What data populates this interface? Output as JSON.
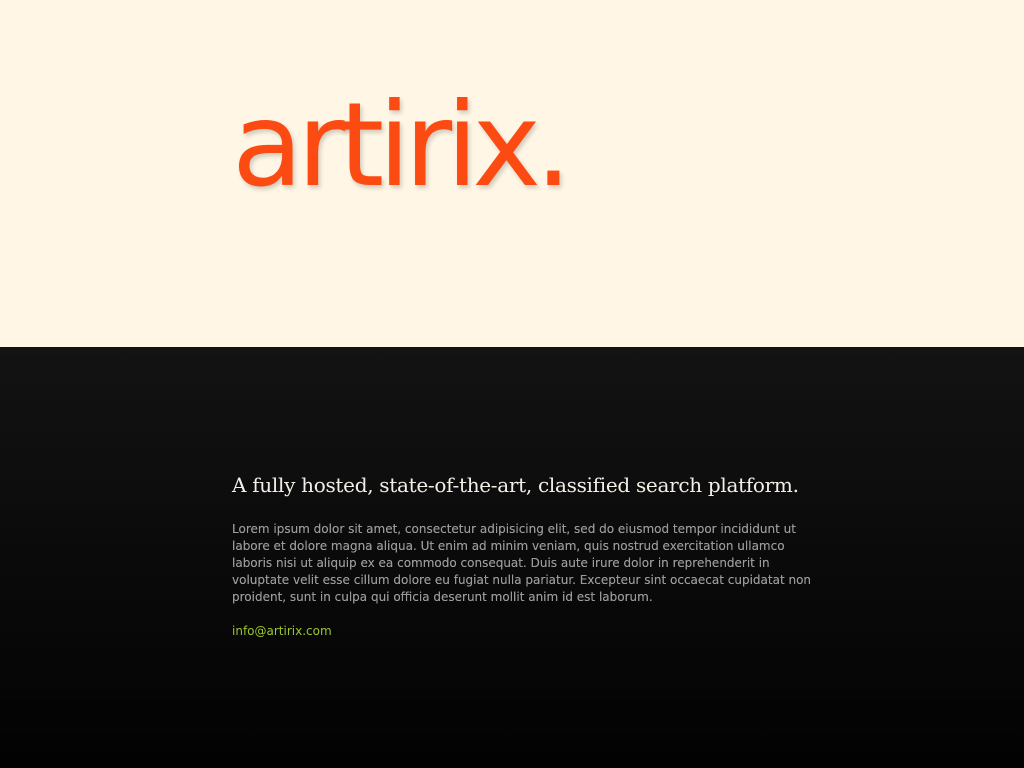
{
  "brand": {
    "logo_text": "artirix.",
    "logo_color": "#fb4a12"
  },
  "hero": {
    "background": "#fff6e5"
  },
  "content": {
    "tagline": "A fully hosted, state-of-the-art, classified search platform.",
    "body": "Lorem ipsum dolor sit amet, consectetur adipisicing elit, sed do eiusmod tempor incididunt ut labore et dolore magna aliqua. Ut enim ad minim veniam, quis nostrud exercitation ullamco laboris nisi ut aliquip ex ea commodo consequat. Duis aute irure dolor in reprehenderit in voluptate velit esse cillum dolore eu fugiat nulla pariatur. Excepteur sint occaecat cupidatat non proident, sunt in culpa qui officia deserunt mollit anim id est laborum.",
    "email": "info@artirix.com",
    "email_color": "#9cc52b"
  }
}
